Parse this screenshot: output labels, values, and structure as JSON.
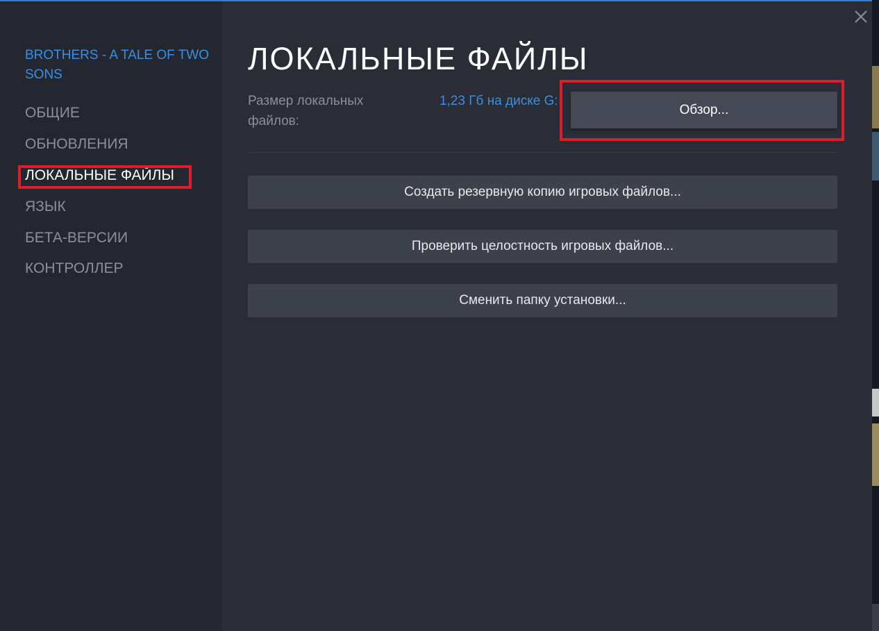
{
  "sidebar": {
    "game_title": "BROTHERS - A TALE OF TWO SONS",
    "items": [
      {
        "label": "ОБЩИЕ",
        "active": false
      },
      {
        "label": "ОБНОВЛЕНИЯ",
        "active": false
      },
      {
        "label": "ЛОКАЛЬНЫЕ ФАЙЛЫ",
        "active": true
      },
      {
        "label": "ЯЗЫК",
        "active": false
      },
      {
        "label": "БЕТА-ВЕРСИИ",
        "active": false
      },
      {
        "label": "КОНТРОЛЛЕР",
        "active": false
      }
    ]
  },
  "main": {
    "title": "ЛОКАЛЬНЫЕ ФАЙЛЫ",
    "size_label": "Размер локальных файлов:",
    "size_value": "1,23 Гб на диске G:",
    "browse_label": "Обзор...",
    "backup_label": "Создать резервную копию игровых файлов...",
    "verify_label": "Проверить целостность игровых файлов...",
    "move_label": "Сменить папку установки..."
  },
  "icons": {
    "close": "close-icon"
  },
  "colors": {
    "accent_blue": "#3a8fe3",
    "highlight_red": "#e01b2a",
    "background": "#2a2d36",
    "sidebar": "#24272f",
    "button": "#3d414c"
  }
}
